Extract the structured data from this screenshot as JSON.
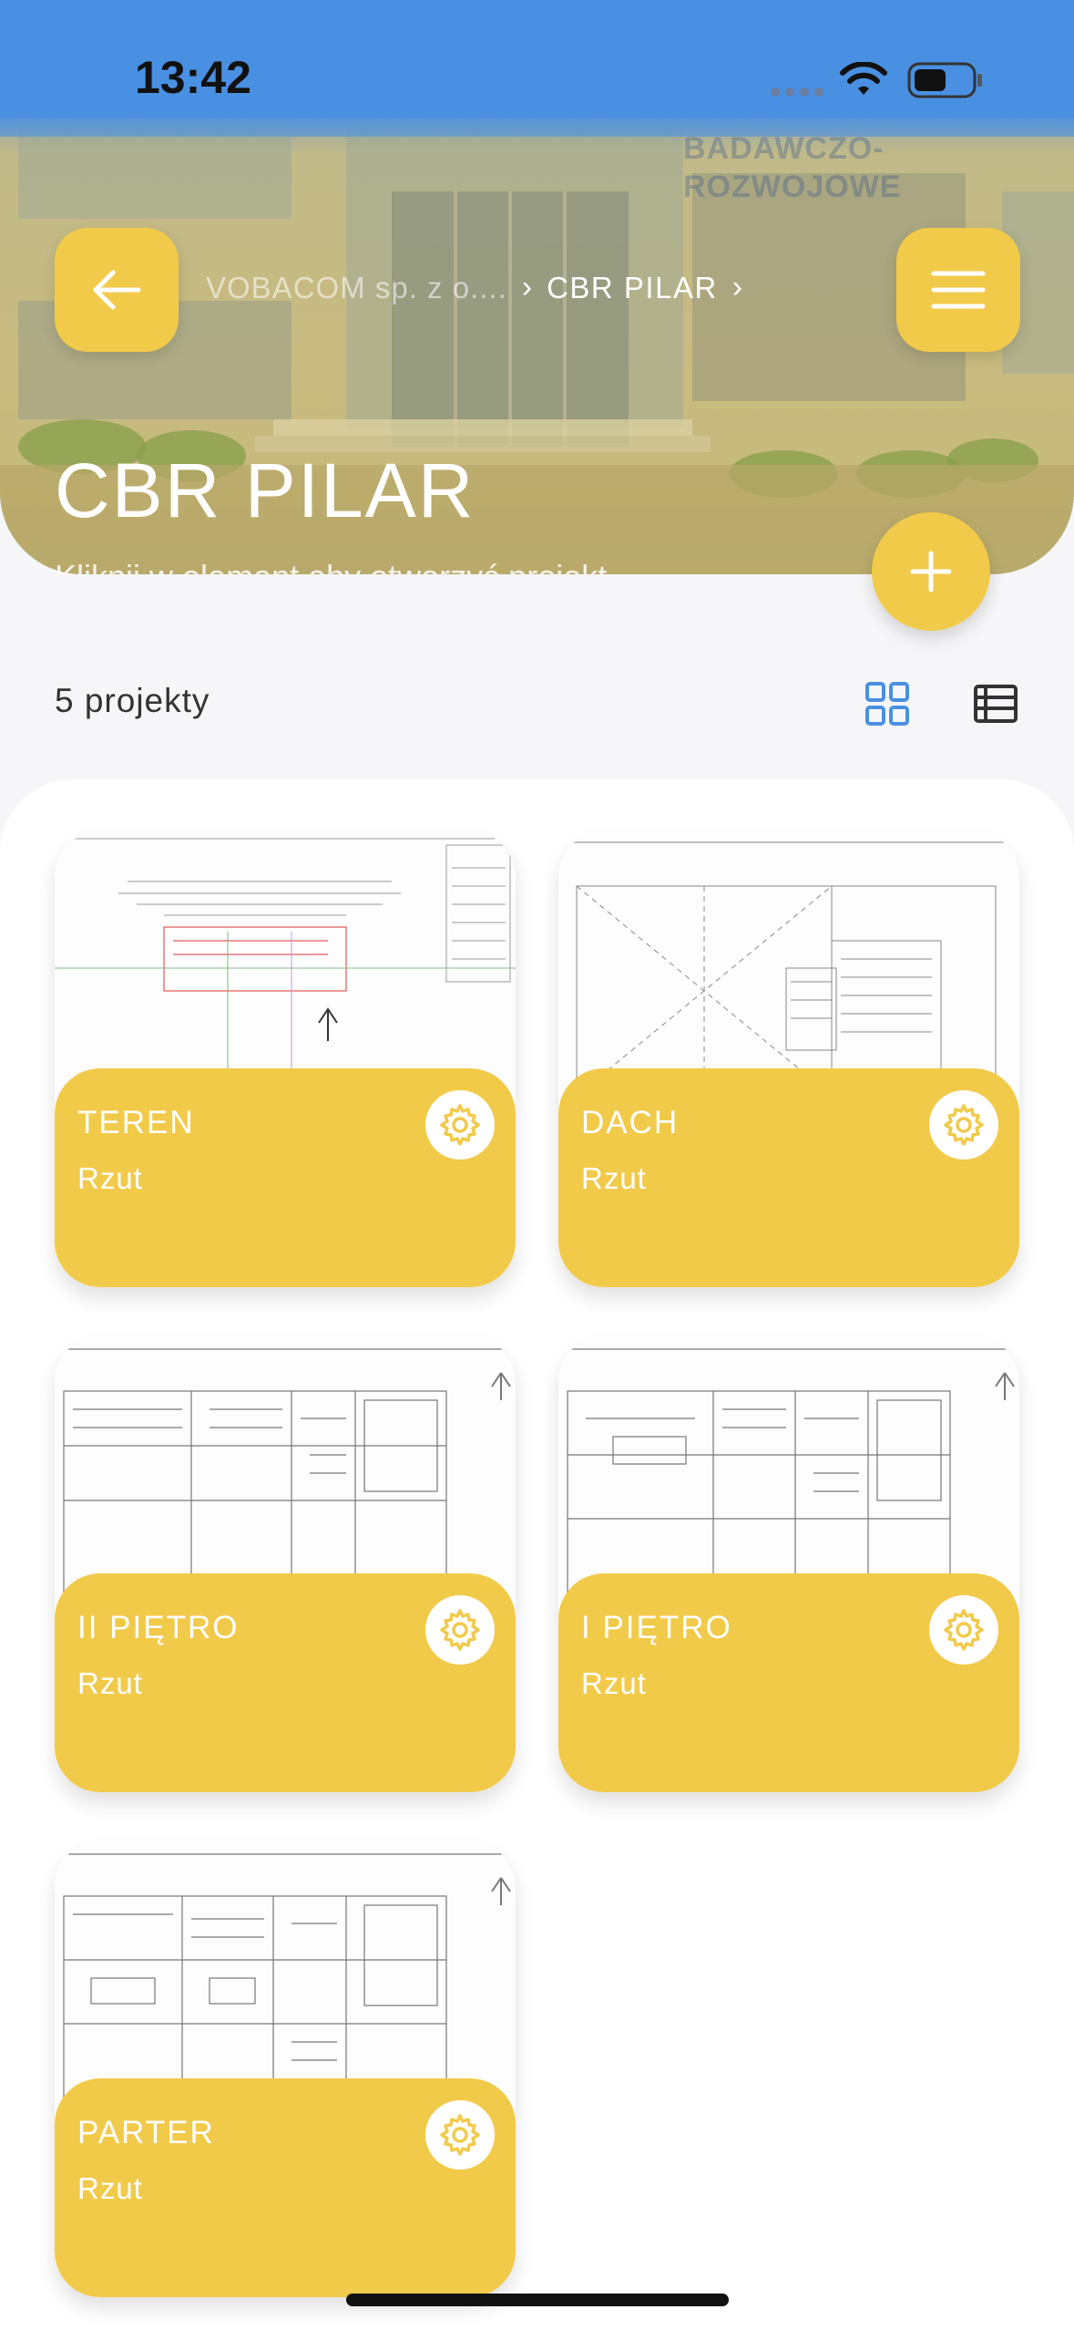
{
  "status_bar": {
    "time": "13:42"
  },
  "header": {
    "background_sign": [
      "BADAWCZO-",
      "ROZWOJOWE"
    ],
    "breadcrumb": {
      "parent": "VOBACOM sp. z o....",
      "current": "CBR PILAR"
    },
    "title": "CBR PILAR",
    "subtitle": "Kliknij w element aby otworzyć projekt"
  },
  "toolbar": {
    "project_count": "5 projekty",
    "view_modes": [
      "grid",
      "list"
    ],
    "active_view": "grid"
  },
  "icons": {
    "back": "arrow-left-icon",
    "menu": "hamburger-menu-icon",
    "add": "plus-icon",
    "grid": "grid-view-icon",
    "list": "list-view-icon",
    "settings": "gear-icon"
  },
  "colors": {
    "accent": "#f2ca4a",
    "status_bar": "#4a90e2",
    "grid_active": "#4a90e2"
  },
  "projects": [
    {
      "name": "TEREN",
      "type": "Rzut"
    },
    {
      "name": "DACH",
      "type": "Rzut"
    },
    {
      "name": "II PIĘTRO",
      "type": "Rzut"
    },
    {
      "name": "I PIĘTRO",
      "type": "Rzut"
    },
    {
      "name": "PARTER",
      "type": "Rzut"
    }
  ]
}
